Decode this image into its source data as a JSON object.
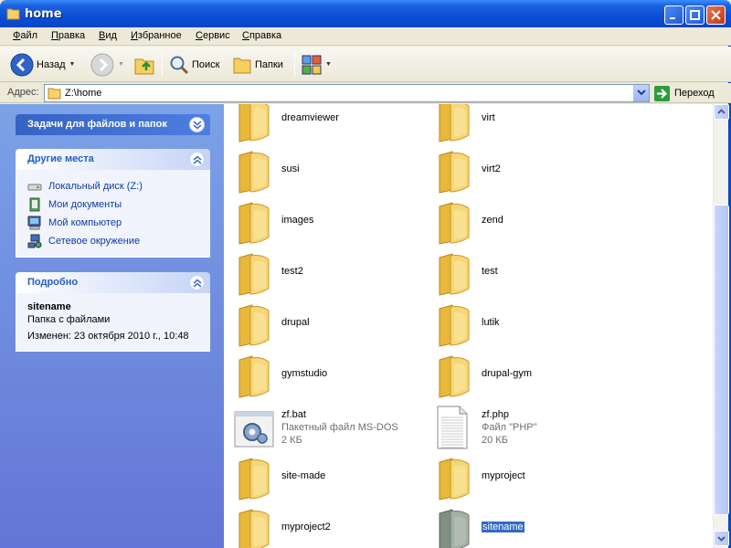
{
  "window": {
    "title": "home"
  },
  "menu": [
    "Файл",
    "Правка",
    "Вид",
    "Избранное",
    "Сервис",
    "Справка"
  ],
  "toolbar": {
    "back_label": "Назад",
    "search_label": "Поиск",
    "folders_label": "Папки"
  },
  "address": {
    "label": "Адрес:",
    "value": "Z:\\home",
    "go_label": "Переход"
  },
  "taskpane": {
    "tasks_title": "Задачи для файлов и папок",
    "places_title": "Другие места",
    "places": [
      {
        "label": "Локальный диск (Z:)",
        "icon": "drive-icon"
      },
      {
        "label": "Мои документы",
        "icon": "my-documents-icon"
      },
      {
        "label": "Мой компьютер",
        "icon": "my-computer-icon"
      },
      {
        "label": "Сетевое окружение",
        "icon": "network-icon"
      }
    ],
    "details_title": "Подробно",
    "details": {
      "name": "sitename",
      "type": "Папка с файлами",
      "modified": "Изменен: 23 октября 2010 г., 10:48"
    }
  },
  "items": [
    {
      "name": "dreamviewer",
      "type": "folder"
    },
    {
      "name": "virt",
      "type": "folder"
    },
    {
      "name": "susi",
      "type": "folder"
    },
    {
      "name": "virt2",
      "type": "folder"
    },
    {
      "name": "images",
      "type": "folder"
    },
    {
      "name": "zend",
      "type": "folder"
    },
    {
      "name": "test2",
      "type": "folder"
    },
    {
      "name": "test",
      "type": "folder"
    },
    {
      "name": "drupal",
      "type": "folder"
    },
    {
      "name": "lutik",
      "type": "folder"
    },
    {
      "name": "gymstudio",
      "type": "folder"
    },
    {
      "name": "drupal-gym",
      "type": "folder"
    },
    {
      "name": "zf.bat",
      "type": "bat",
      "desc": "Пакетный файл MS-DOS",
      "size": "2 КБ"
    },
    {
      "name": "zf.php",
      "type": "php",
      "desc": "Файл \"PHP\"",
      "size": "20 КБ"
    },
    {
      "name": "site-made",
      "type": "folder"
    },
    {
      "name": "myproject",
      "type": "folder"
    },
    {
      "name": "myproject2",
      "type": "folder"
    },
    {
      "name": "sitename",
      "type": "folder-selected",
      "selected": true
    }
  ],
  "colors": {
    "titlebar": "#0a4fd6",
    "taskpane": "#7ba2e7",
    "selection": "#316ac5",
    "folder": "#f5d36a"
  }
}
